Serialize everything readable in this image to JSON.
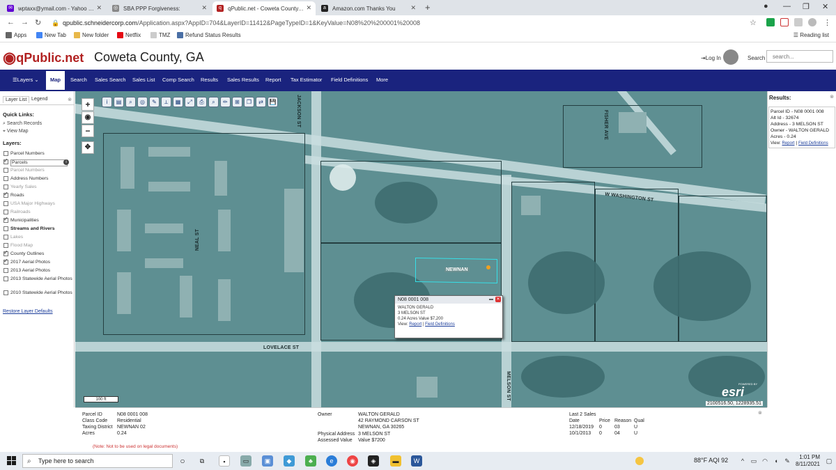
{
  "browser": {
    "tabs": [
      {
        "label": "wptaxx@ymail.com - Yahoo Mail",
        "color": "#6001d2"
      },
      {
        "label": "SBA PPP Forgiveness:",
        "color": "#888888"
      },
      {
        "label": "qPublic.net - Coweta County, GA",
        "color": "#b22222"
      },
      {
        "label": "Amazon.com Thanks You",
        "color": "#222222"
      }
    ],
    "url_host": "qpublic.schneidercorp.com",
    "url_path": "/Application.aspx?AppID=704&LayerID=11412&PageTypeID=1&KeyValue=N08%20%200001%20008",
    "bookmarks": [
      "Apps",
      "New Tab",
      "New folder",
      "Netflix",
      "TMZ",
      "Refund Status Results"
    ],
    "reading_list": "Reading list"
  },
  "site": {
    "brand": "qPublic.net",
    "county": "Coweta County, GA",
    "login": "Log In",
    "search_label": "Search",
    "search_placeholder": "search..."
  },
  "nav": {
    "items": [
      "Layers",
      "Map",
      "Search",
      "Sales Search",
      "Sales List",
      "Comp Search",
      "Results",
      "Sales Results",
      "Report",
      "Tax Estimator",
      "Field Definitions",
      "More"
    ],
    "active": "Map"
  },
  "left_panel": {
    "tabs": [
      "Layer List",
      "Legend"
    ],
    "quick_links_title": "Quick Links:",
    "quick_links": [
      "Search Records",
      "View Map"
    ],
    "layers_title": "Layers:",
    "layers": [
      {
        "label": "Parcel Numbers",
        "checked": false,
        "style": "normal"
      },
      {
        "label": "Parcels",
        "checked": true,
        "style": "boxed"
      },
      {
        "label": "Parcel Numbers",
        "checked": false,
        "style": "dim"
      },
      {
        "label": "Address Numbers",
        "checked": false,
        "style": "normal"
      },
      {
        "label": "Yearly Sales",
        "checked": false,
        "style": "dim"
      },
      {
        "label": "Roads",
        "checked": true,
        "style": "normal"
      },
      {
        "label": "USA Major Highways",
        "checked": false,
        "style": "dim"
      },
      {
        "label": "Railroads",
        "checked": false,
        "style": "dim"
      },
      {
        "label": "Municipalities",
        "checked": true,
        "style": "normal"
      },
      {
        "label": "Streams and Rivers",
        "checked": false,
        "style": "bold"
      },
      {
        "label": "Lakes",
        "checked": false,
        "style": "dim"
      },
      {
        "label": "Flood Map",
        "checked": false,
        "style": "dim"
      },
      {
        "label": "County Outlines",
        "checked": true,
        "style": "normal"
      },
      {
        "label": "2017 Aerial Photos",
        "checked": true,
        "style": "normal"
      },
      {
        "label": "2013 Aerial Photos",
        "checked": false,
        "style": "normal"
      },
      {
        "label": "2013 Statewide Aerial Photos",
        "checked": false,
        "style": "normal"
      },
      {
        "label": "2010 Statewide Aerial Photos",
        "checked": false,
        "style": "normal"
      }
    ],
    "restore": "Restore Layer Defaults"
  },
  "map": {
    "streets": [
      "W WASHINGTON ST",
      "LOVELACE ST",
      "MELSON ST",
      "NEAL ST",
      "JACKSON ST",
      "FISHER AVE"
    ],
    "city_label": "NEWNAN",
    "scale": "100 ft",
    "esri": "esri",
    "esri_powered": "POWERED BY",
    "coords": "2100516.50, 1228935.51",
    "popup": {
      "title": "N08 0001 008",
      "owner": "WALTON GERALD",
      "address": "3 MELSON ST",
      "acres_value": "0.24 Acres  Value $7,200",
      "view_label": "View:",
      "report_link": "Report",
      "fielddef_link": "Field Definitions"
    }
  },
  "results": {
    "title": "Results:",
    "parcel": "Parcel ID - N08 0001 008",
    "alt": "Alt Id - 32674",
    "address": "Address - 3 MELSON ST",
    "owner": "Owner - WALTON GERALD",
    "acres": "Acres - 0.24",
    "view_label": "View:",
    "report_link": "Report",
    "fielddef_link": "Field Definitions"
  },
  "detail": {
    "labels": [
      "Parcel ID",
      "Class Code",
      "Taxing District",
      "Acres"
    ],
    "values": [
      "N08 0001 008",
      "Residential",
      "NEWNAN 02",
      "0.24"
    ],
    "note": "(Note: Not to be used on legal documents)",
    "owner_label": "Owner",
    "owner_lines": [
      "WALTON GERALD",
      "42 RAYMOND CARSON ST",
      "NEWNAN, GA 30265"
    ],
    "phys_label": "Physical Address",
    "phys_value": "3 MELSON ST",
    "assessed_label": "Assessed Value",
    "assessed_value": "Value $7200",
    "sales_title": "Last 2 Sales",
    "sales_headers": [
      "Date",
      "Price",
      "Reason",
      "Qual"
    ],
    "sales_rows": [
      [
        "12/18/2019",
        "0",
        "03",
        "U"
      ],
      [
        "10/1/2013",
        "0",
        "04",
        "U"
      ]
    ]
  },
  "taskbar": {
    "search_placeholder": "Type here to search",
    "weather": "88°F  AQI 92",
    "time": "1:01 PM",
    "date": "8/11/2021"
  }
}
